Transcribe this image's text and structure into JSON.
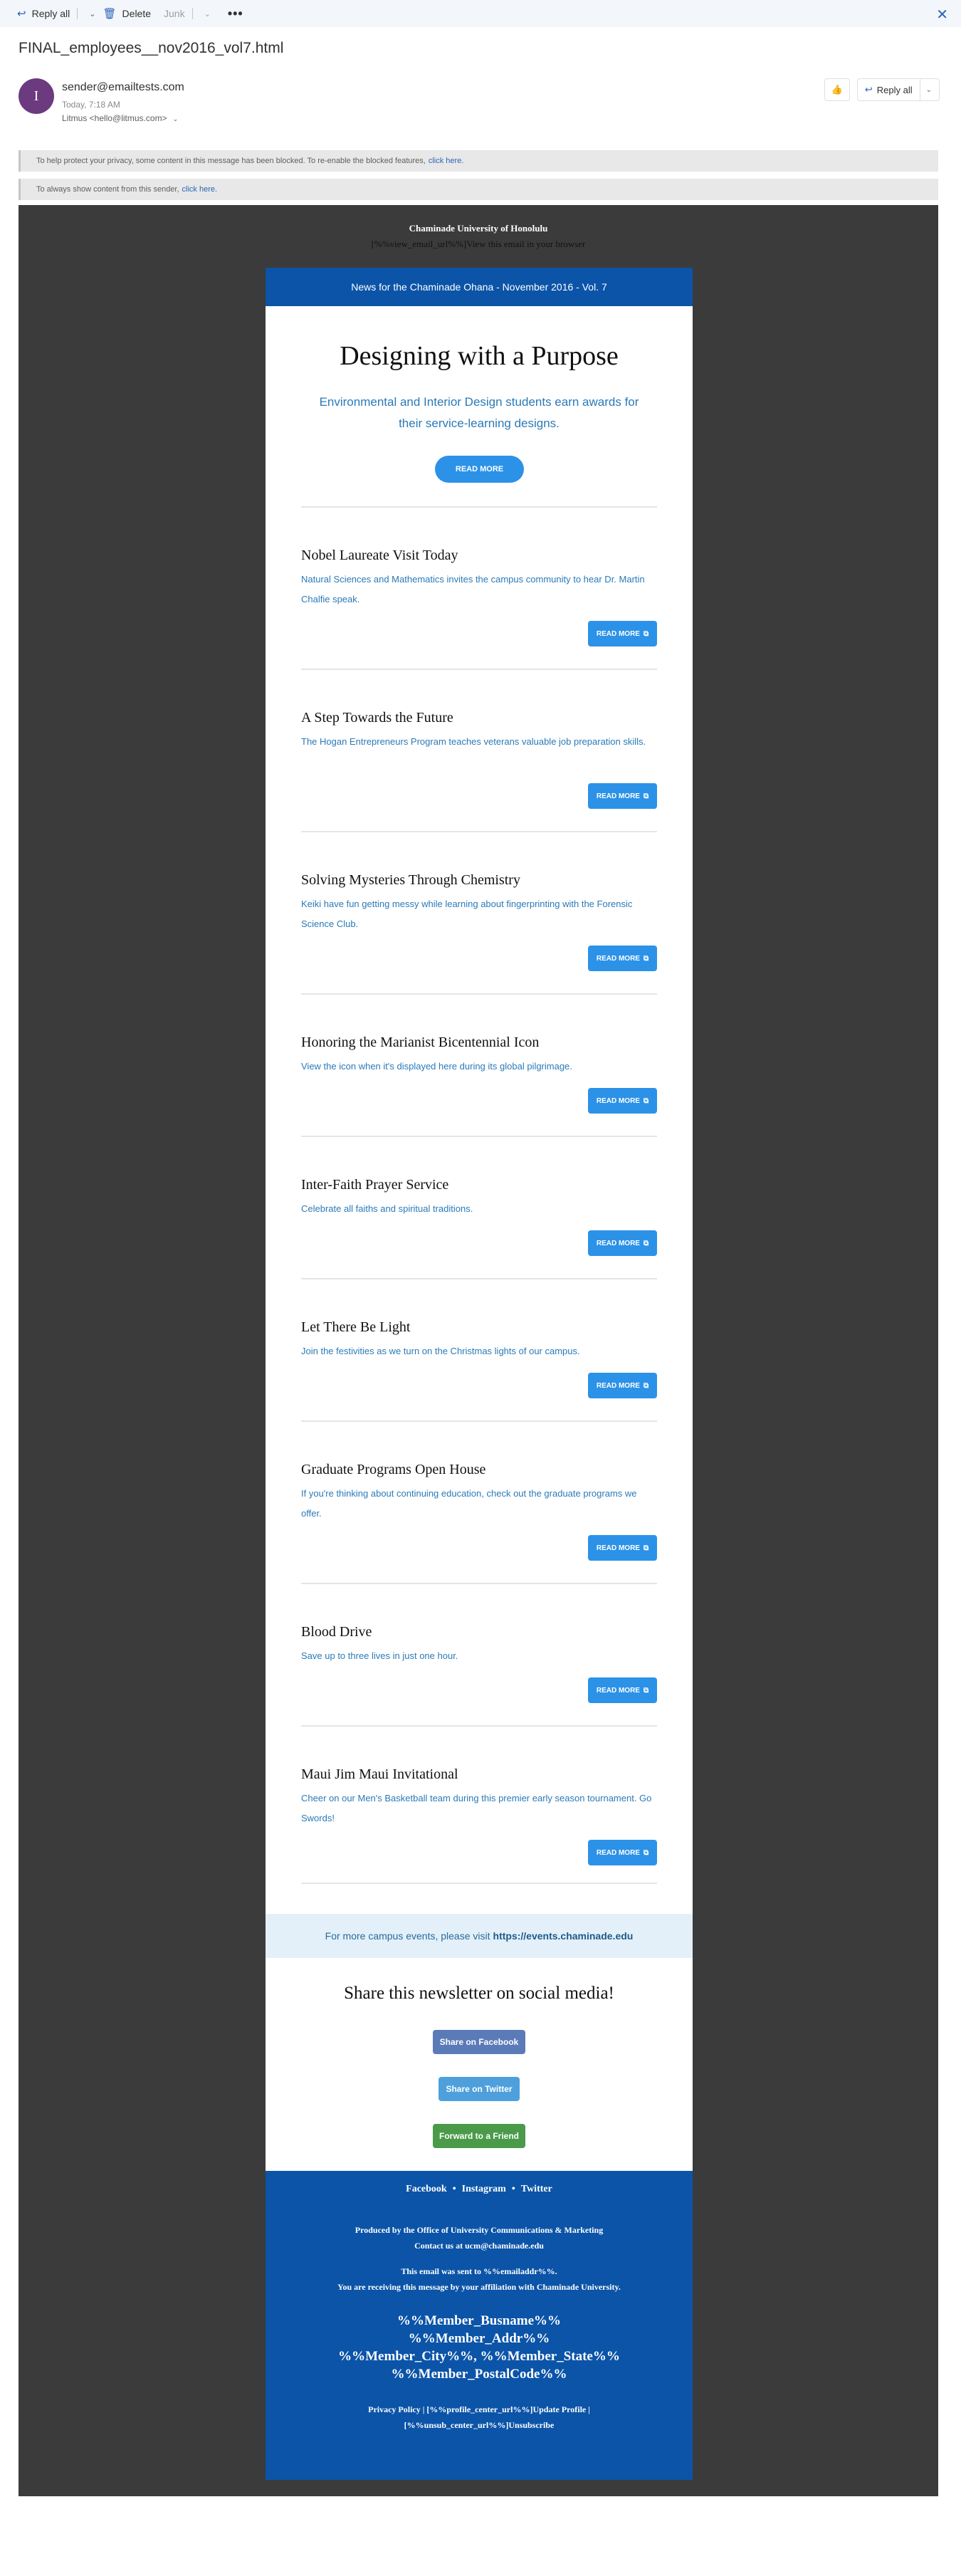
{
  "toolbar": {
    "reply_all": "Reply all",
    "delete": "Delete",
    "junk": "Junk",
    "more": "•••",
    "close": "✕"
  },
  "message": {
    "subject": "FINAL_employees__nov2016_vol7.html",
    "avatar_initial": "I",
    "sender": "sender@emailtests.com",
    "time": "Today, 7:18 AM",
    "to": "Litmus <hello@litmus.com>",
    "reply_all_btn": "Reply all"
  },
  "notices": {
    "privacy_text": "To help protect your privacy, some content in this message has been blocked. To re-enable the blocked features,",
    "privacy_link": "click here.",
    "sender_text": "To always show content from this sender,",
    "sender_link": "click here."
  },
  "email": {
    "org_name": "Chaminade University of Honolulu",
    "view_in_browser": "[%%view_email_url%%]View this email in your browser",
    "banner": "News for the Chaminade Ohana - November 2016 - Vol. 7",
    "hero": {
      "title": "Designing with a Purpose",
      "subtitle": "Environmental and Interior Design students earn awards for their service-learning designs.",
      "button": "READ MORE"
    },
    "stories": [
      {
        "title": "Nobel Laureate Visit Today",
        "text": "Natural Sciences and Mathematics invites the campus community to hear Dr. Martin Chalfie speak.",
        "button": "READ MORE"
      },
      {
        "title": "A Step Towards the Future",
        "text": "The Hogan Entrepreneurs Program teaches veterans valuable job preparation skills.",
        "button": "READ MORE"
      },
      {
        "title": "Solving Mysteries Through Chemistry",
        "text": "Keiki have fun getting messy while learning about fingerprinting with the Forensic Science Club.",
        "button": "READ MORE"
      },
      {
        "title": "Honoring the Marianist Bicentennial Icon",
        "text": "View the icon when it's displayed here during its global pilgrimage.",
        "button": "READ MORE"
      },
      {
        "title": "Inter-Faith Prayer Service",
        "text": "Celebrate all faiths and spiritual traditions.",
        "button": "READ MORE"
      },
      {
        "title": "Let There Be Light",
        "text": "Join the festivities as we turn on the Christmas lights of our campus.",
        "button": "READ MORE"
      },
      {
        "title": "Graduate Programs Open House",
        "text": "If you're thinking about continuing education, check out the graduate programs we offer.",
        "button": "READ MORE"
      },
      {
        "title": "Blood Drive",
        "text": "Save up to three lives in just one hour.",
        "button": "READ MORE"
      },
      {
        "title": "Maui Jim Maui Invitational",
        "text": "Cheer on our Men's Basketball team during this premier early season tournament. Go Swords!",
        "button": "READ MORE"
      }
    ],
    "events": {
      "text": "For more campus events, please visit",
      "link": "https://events.chaminade.edu"
    },
    "share": {
      "title": "Share this newsletter on social media!",
      "facebook": "Share on Facebook",
      "twitter": "Share on Twitter",
      "forward": "Forward to a Friend"
    },
    "footer": {
      "links": [
        "Facebook",
        "Instagram",
        "Twitter"
      ],
      "produced_by": "Produced by the Office of University Communications & Marketing",
      "contact": "Contact us at ucm@chaminade.edu",
      "sent_to": "This email was sent to %%emailaddr%%.",
      "affiliation": "You are receiving this message by your affiliation with Chaminade University.",
      "member_lines": [
        "%%Member_Busname%%",
        "%%Member_Addr%%",
        "%%Member_City%%, %%Member_State%%",
        "%%Member_PostalCode%%"
      ],
      "policy_line": "Privacy Policy   |   [%%profile_center_url%%]Update Profile   |",
      "unsub_line": "[%%unsub_center_url%%]Unsubscribe"
    }
  },
  "colors": {
    "banner_blue": "#0b54a8",
    "button_blue": "#2c92e8",
    "text_blue": "#2a7ab8",
    "facebook": "#5b7ab8",
    "twitter": "#4ea0dc",
    "forward": "#4a9a4a",
    "avatar": "#6b3a7f"
  },
  "icons": {
    "reply_all": "reply-all-icon",
    "delete": "trash-icon",
    "external": "external-link-icon"
  }
}
